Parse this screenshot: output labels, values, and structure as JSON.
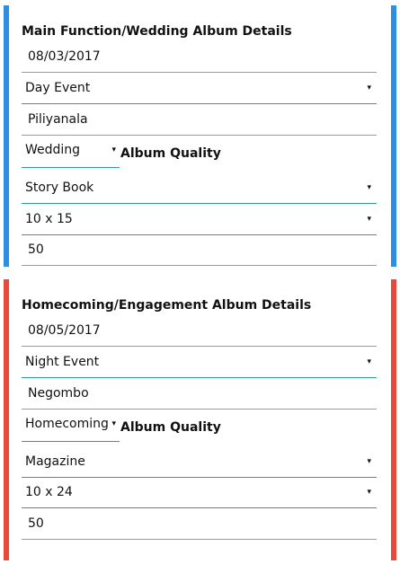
{
  "wedding": {
    "title": "Main Function/Wedding Album Details",
    "date": "08/03/2017",
    "event_time": "Day Event",
    "location": "Piliyanala",
    "function_type": "Wedding",
    "album_quality_label": "Album Quality",
    "album_style": "Story Book",
    "album_size": "10 x 15",
    "page_count": "50",
    "accent_color": "#2b8fe6"
  },
  "homecoming": {
    "title": "Homecoming/Engagement Album Details",
    "date": "08/05/2017",
    "event_time": "Night Event",
    "location": "Negombo",
    "function_type": "Homecoming",
    "album_quality_label": "Album Quality",
    "album_style": "Magazine",
    "album_size": "10 x 24",
    "page_count": "50",
    "accent_color": "#e9483a"
  },
  "icons": {
    "dropdown": "▾"
  }
}
